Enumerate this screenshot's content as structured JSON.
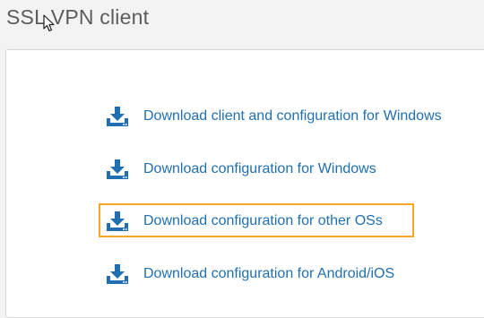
{
  "page": {
    "title": "SSL VPN client"
  },
  "downloads": [
    {
      "label": "Download client and configuration for Windows",
      "icon": "download-icon"
    },
    {
      "label": "Download configuration for Windows",
      "icon": "download-icon"
    },
    {
      "label": "Download configuration for other OSs",
      "icon": "download-icon",
      "highlighted": true
    },
    {
      "label": "Download configuration for Android/iOS",
      "icon": "download-icon"
    }
  ],
  "colors": {
    "link": "#1f6fb2",
    "highlight": "#f5a623",
    "title": "#5c5c5c",
    "background": "#f3f3f3",
    "panel": "#ffffff"
  }
}
